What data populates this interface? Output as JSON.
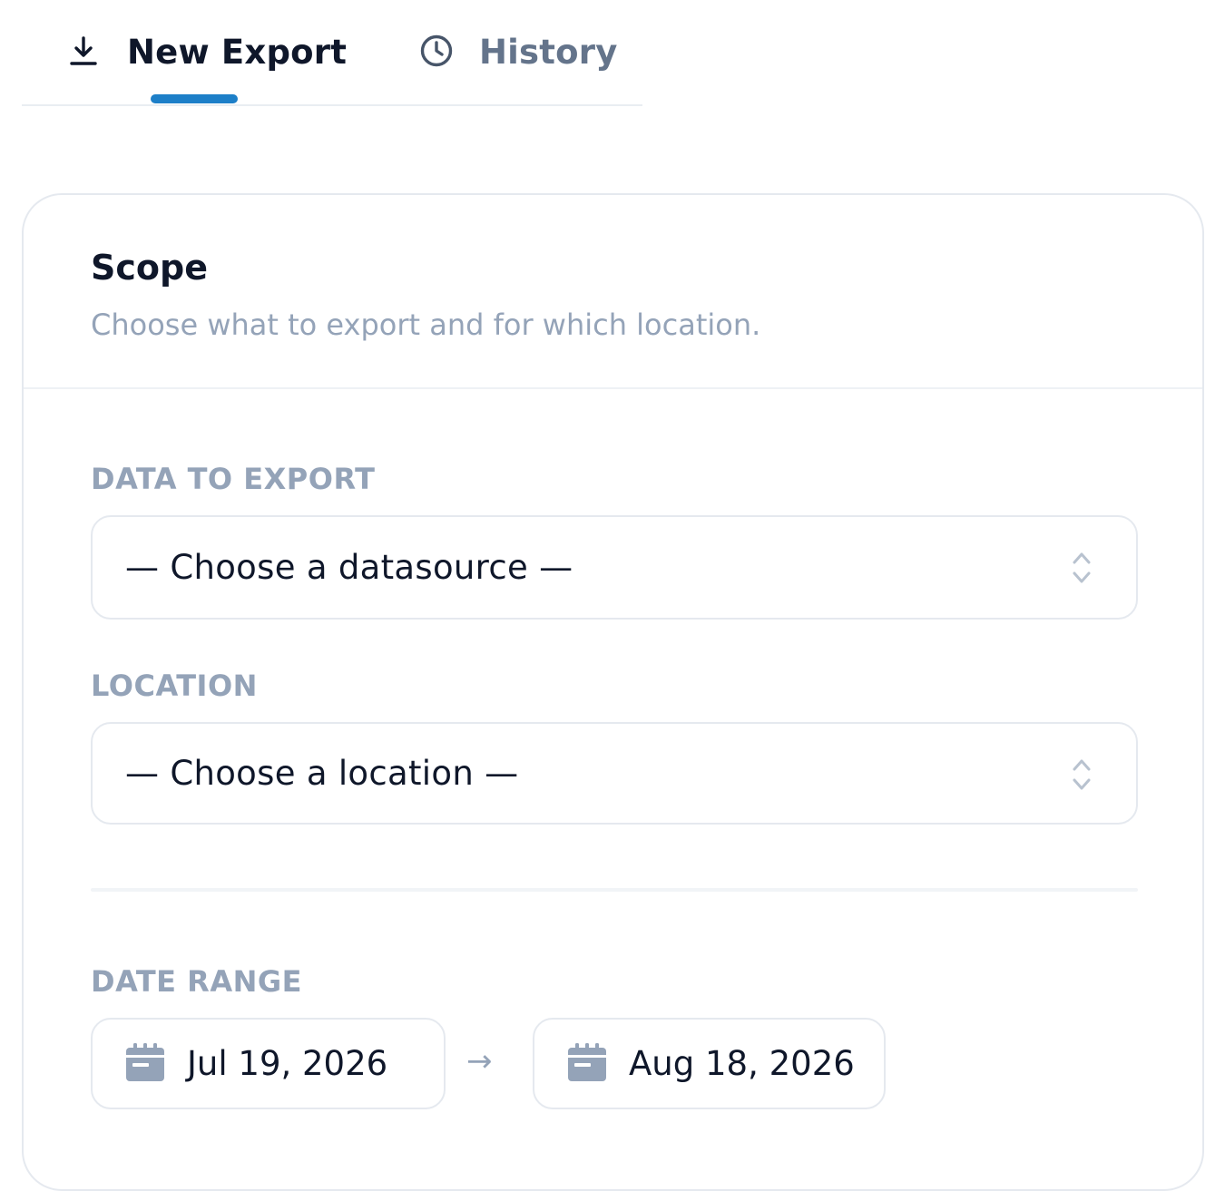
{
  "tabs": {
    "new_export": {
      "label": "New Export",
      "icon": "download-icon",
      "active": true
    },
    "history": {
      "label": "History",
      "icon": "clock-icon",
      "active": false
    }
  },
  "scope": {
    "title": "Scope",
    "subtitle": "Choose what to export and for which location.",
    "data_to_export": {
      "label": "DATA TO EXPORT",
      "selected": "— Choose a datasource —",
      "icon": "chevron-up-down-icon"
    },
    "location": {
      "label": "LOCATION",
      "selected": "— Choose a location —",
      "icon": "chevron-up-down-icon"
    },
    "date_range": {
      "label": "DATE RANGE",
      "start": "Jul 19, 2026",
      "end": "Aug 18, 2026",
      "separator": "→",
      "icon": "calendar-icon"
    }
  },
  "colors": {
    "accent": "#1d7fc8",
    "text_primary": "#0f172a",
    "text_muted": "#94a3b8",
    "border": "#e5e9ef"
  }
}
